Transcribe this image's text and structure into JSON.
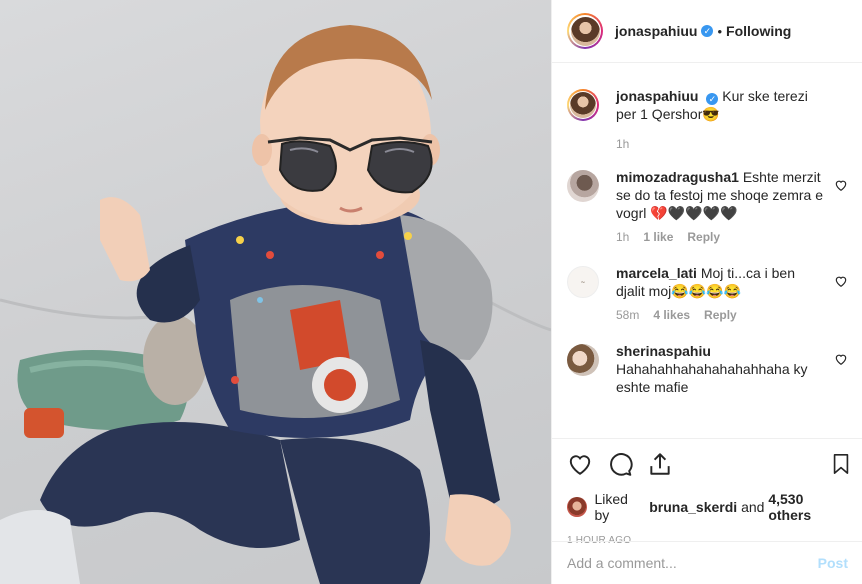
{
  "post": {
    "author": "jonaspahiuu",
    "follow_separator": "•",
    "follow_status": "Following",
    "caption": "Kur ske terezi per 1 Qershor😎",
    "caption_time": "1h",
    "image_alt": "Baby wearing aviator sunglasses sitting on a grey sofa"
  },
  "comments": [
    {
      "user": "mimozadragusha1",
      "text": "Eshte merzit se do ta festoj me shoqe zemra e vogrl 💔🖤🖤🖤🖤",
      "time": "1h",
      "likes": "1 like",
      "reply": "Reply"
    },
    {
      "user": "marcela_lati",
      "text": "Moj ti...ca i ben djalit moj😂😂😂😂",
      "time": "58m",
      "likes": "4 likes",
      "reply": "Reply"
    },
    {
      "user": "sherinaspahiu",
      "text": "Hahahahhahahahahahhaha ky eshte mafie",
      "time": "",
      "likes": "",
      "reply": ""
    }
  ],
  "actions": {
    "liked_by_prefix": "Liked by",
    "liked_by_user": "bruna_skerdi",
    "liked_by_and": "and",
    "liked_by_others": "4,530 others",
    "time_ago": "1 HOUR AGO"
  },
  "add_comment": {
    "placeholder": "Add a comment...",
    "post_label": "Post"
  },
  "colors": {
    "verified": "#3897f0",
    "muted": "#999999",
    "post_disabled": "#b2dffc"
  },
  "icons": [
    "verified-badge-icon",
    "heart-icon",
    "comment-icon",
    "share-icon",
    "bookmark-icon"
  ]
}
